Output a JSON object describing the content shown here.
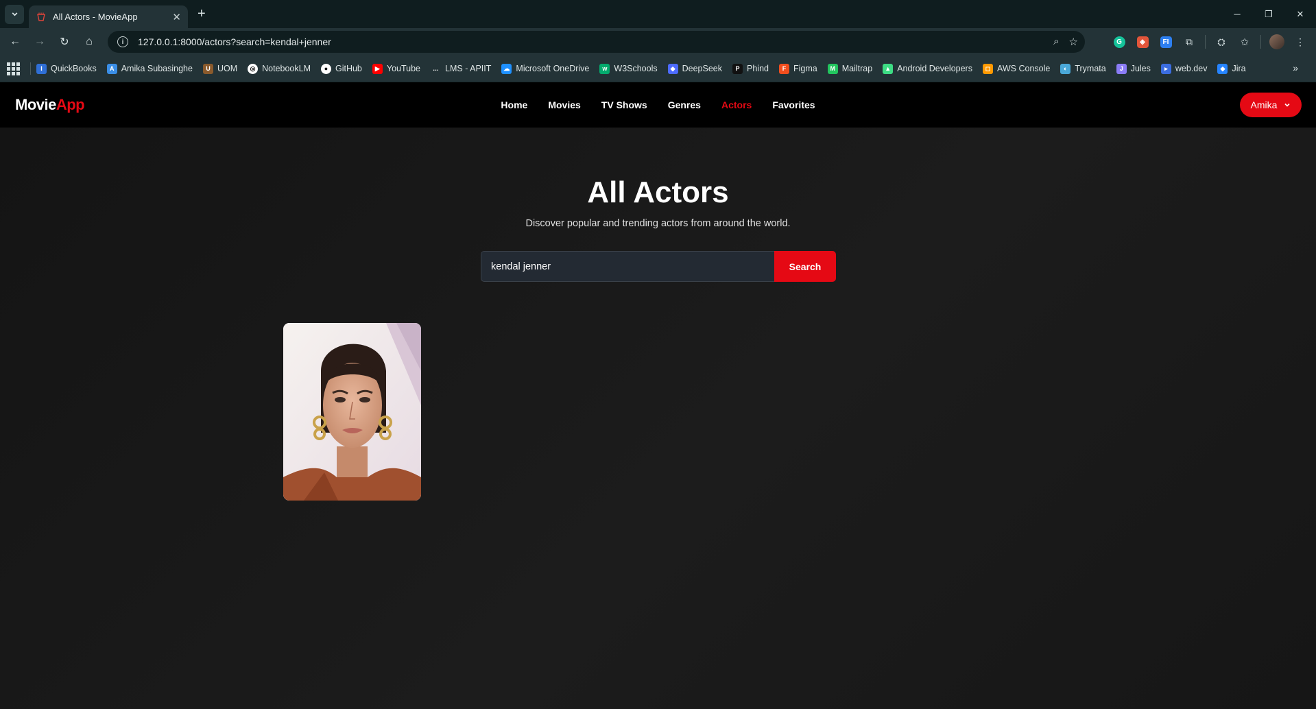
{
  "browser": {
    "tab_title": "All Actors - MovieApp",
    "url": "127.0.0.1:8000/actors?search=kendal+jenner",
    "bookmarks": [
      {
        "label": "QuickBooks",
        "color": "#2f6fd6",
        "glyph": "I"
      },
      {
        "label": "Amika Subasinghe",
        "color": "#3a8ee6",
        "glyph": "A"
      },
      {
        "label": "UOM",
        "color": "#8a5a2c",
        "glyph": "U"
      },
      {
        "label": "NotebookLM",
        "color": "#ffffff",
        "glyph": "◎"
      },
      {
        "label": "GitHub",
        "color": "#ffffff",
        "glyph": "●"
      },
      {
        "label": "YouTube",
        "color": "#ff0000",
        "glyph": "▶"
      },
      {
        "label": "LMS - APIIT",
        "color": "#233337",
        "glyph": "…"
      },
      {
        "label": "Microsoft OneDrive",
        "color": "#1e90ff",
        "glyph": "☁"
      },
      {
        "label": "W3Schools",
        "color": "#04aa6d",
        "glyph": "w"
      },
      {
        "label": "DeepSeek",
        "color": "#4d6bfe",
        "glyph": "◆"
      },
      {
        "label": "Phind",
        "color": "#111111",
        "glyph": "P"
      },
      {
        "label": "Figma",
        "color": "#f24e1e",
        "glyph": "F"
      },
      {
        "label": "Mailtrap",
        "color": "#22c55e",
        "glyph": "M"
      },
      {
        "label": "Android Developers",
        "color": "#3ddc84",
        "glyph": "▲"
      },
      {
        "label": "AWS Console",
        "color": "#ff9900",
        "glyph": "◻"
      },
      {
        "label": "Trymata",
        "color": "#4aa8d8",
        "glyph": "◐"
      },
      {
        "label": "Jules",
        "color": "#8b7cf6",
        "glyph": "J"
      },
      {
        "label": "web.dev",
        "color": "#3b6de0",
        "glyph": "▸"
      },
      {
        "label": "Jira",
        "color": "#2684ff",
        "glyph": "◆"
      }
    ]
  },
  "app": {
    "logo_part1": "Movie",
    "logo_part2": "App",
    "nav": [
      "Home",
      "Movies",
      "TV Shows",
      "Genres",
      "Actors",
      "Favorites"
    ],
    "active_nav": "Actors",
    "user_name": "Amika"
  },
  "page": {
    "title": "All Actors",
    "subtitle": "Discover popular and trending actors from around the world.",
    "search_value": "kendal jenner",
    "search_button": "Search"
  },
  "colors": {
    "accent": "#e50914",
    "background": "#141414"
  }
}
